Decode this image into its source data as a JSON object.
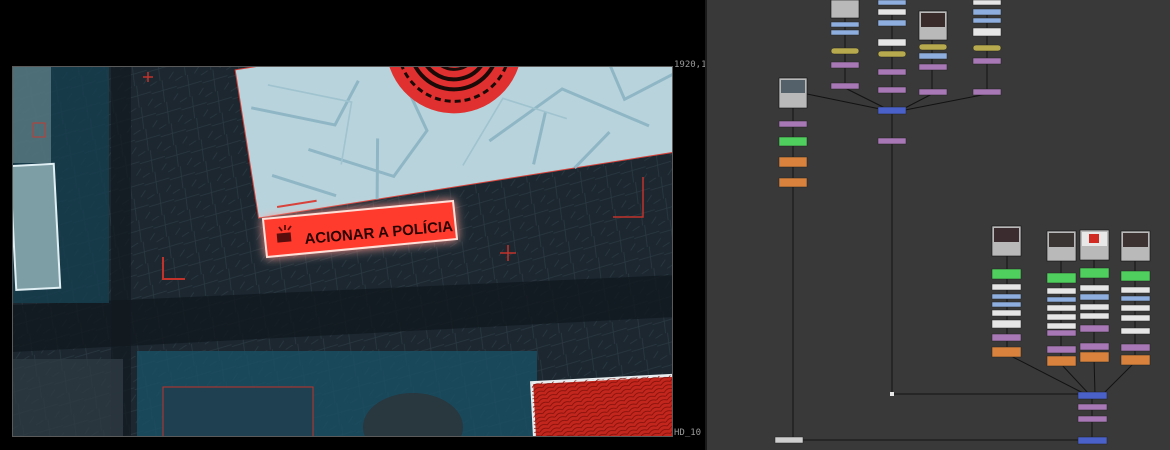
{
  "viewer": {
    "format_top_label": "1920,1",
    "format_bottom_label": "HD_10",
    "police_button_label": "ACIONAR A POLÍCIA"
  },
  "colors": {
    "map_paper": "#b8d3dc",
    "map_roads": "#8fb6c5",
    "target_red": "#e0302f",
    "button_red": "#ff3b2f",
    "dark_map": "#1c2730",
    "grid_bg": "#393939",
    "node_read": "#b9b9b9",
    "node_blue": "#8faee0",
    "node_white": "#e6e6e6",
    "node_yellow": "#b7a94d",
    "node_purple": "#a877b6",
    "node_green": "#4fcf5d",
    "node_orange": "#d8823d",
    "node_merge": "#4961c8",
    "node_write": "#cfcfcf"
  }
}
